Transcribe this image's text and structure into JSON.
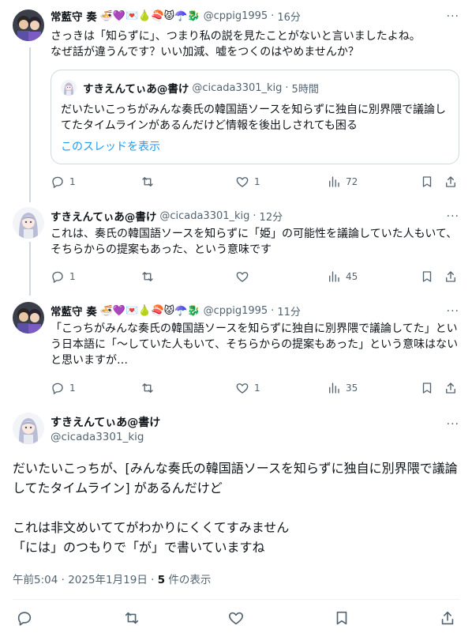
{
  "tweets": [
    {
      "name": "常藍守 奏",
      "emoji": "🍜💜💌🍐🍣😾☂️🐉",
      "handle": "@cppig1995",
      "time": "16分",
      "text": "さっきは「知らずに」、つまり私の説を見たことがないと言いましたよね。\nなぜ話が違うんです？いい加減、嘘をつくのはやめませんか？",
      "quote": {
        "name": "すきえんてぃあ@書け",
        "handle": "@cicada3301_kig",
        "time": "5時間",
        "text": "だいたいこっちがみんな奏氏の韓国語ソースを知らずに独自に別界隈で議論してたタイムラインがあるんだけど情報を後出しされても困る",
        "link": "このスレッドを表示"
      },
      "replies": "1",
      "retweets": "",
      "likes": "1",
      "views": "72"
    },
    {
      "name": "すきえんてぃあ@書け",
      "handle": "@cicada3301_kig",
      "time": "12分",
      "text": "これは、奏氏の韓国語ソースを知らずに「姫」の可能性を議論していた人もいて、そちらからの提案もあった、という意味です",
      "replies": "1",
      "retweets": "",
      "likes": "",
      "views": "45"
    },
    {
      "name": "常藍守 奏",
      "emoji": "🍜💜💌🍐🍣😾☂️🐉",
      "handle": "@cppig1995",
      "time": "11分",
      "text": "「こっちがみんな奏氏の韓国語ソースを知らずに独自に別界隈で議論してた」という日本語に「〜していた人もいて、そちらからの提案もあった」という意味はないと思いますが…",
      "replies": "1",
      "retweets": "",
      "likes": "1",
      "views": "35"
    }
  ],
  "main": {
    "name": "すきえんてぃあ@書け",
    "handle": "@cicada3301_kig",
    "text": "だいたいこっちが、[みんな奏氏の韓国語ソースを知らずに独自に別界隈で議論してたタイムライン] があるんだけど\n\nこれは非文めいててがわかりにくくてすみません\n「には」のつもりで「が」で書いていますね",
    "time": "午前5:04 · 2025年1月19日 · ",
    "views_count": "5",
    "views_label": " 件の表示"
  },
  "more_label": "···",
  "colors": {
    "accent": "#1d9bf0",
    "muted": "#536471",
    "border": "#cfd9de"
  }
}
